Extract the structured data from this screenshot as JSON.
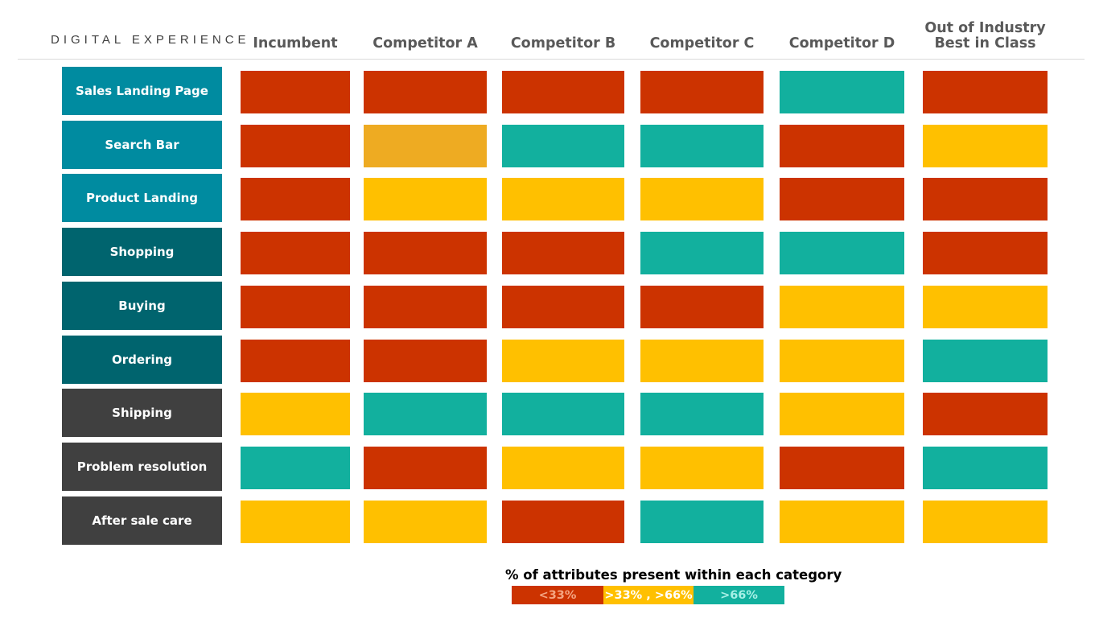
{
  "section_title": "DIGITAL EXPERIENCE",
  "chart_data": {
    "type": "heatmap",
    "title": "DIGITAL EXPERIENCE",
    "columns": [
      "Incumbent",
      "Competitor A",
      "Competitor B",
      "Competitor C",
      "Competitor D",
      "Out of Industry Best in Class"
    ],
    "column_labels": [
      [
        "Incumbent"
      ],
      [
        "Competitor A"
      ],
      [
        "Competitor B"
      ],
      [
        "Competitor C"
      ],
      [
        "Competitor D"
      ],
      [
        "Out of Industry",
        "Best in Class"
      ]
    ],
    "rows": [
      {
        "label": "Sales Landing Page",
        "group": "blue",
        "values": [
          "low",
          "low",
          "low",
          "low",
          "high",
          "low"
        ]
      },
      {
        "label": "Search Bar",
        "group": "blue",
        "values": [
          "low",
          "mid-alt",
          "high",
          "high",
          "low",
          "mid"
        ]
      },
      {
        "label": "Product Landing",
        "group": "blue",
        "values": [
          "low",
          "mid",
          "mid",
          "mid",
          "low",
          "low"
        ]
      },
      {
        "label": "Shopping",
        "group": "teal",
        "values": [
          "low",
          "low",
          "low",
          "high",
          "high",
          "low"
        ]
      },
      {
        "label": "Buying",
        "group": "teal",
        "values": [
          "low",
          "low",
          "low",
          "low",
          "mid",
          "mid"
        ]
      },
      {
        "label": "Ordering",
        "group": "teal",
        "values": [
          "low",
          "low",
          "mid",
          "mid",
          "mid",
          "high"
        ]
      },
      {
        "label": "Shipping",
        "group": "gray",
        "values": [
          "mid",
          "high",
          "high",
          "high",
          "mid",
          "low"
        ]
      },
      {
        "label": "Problem resolution",
        "group": "gray",
        "values": [
          "high",
          "low",
          "mid",
          "mid",
          "low",
          "high"
        ]
      },
      {
        "label": "After sale care",
        "group": "gray",
        "values": [
          "mid",
          "mid",
          "low",
          "high",
          "mid",
          "mid"
        ]
      }
    ],
    "legend": {
      "title": "% of attributes present within each category",
      "entries": [
        {
          "key": "low",
          "label": "<33%"
        },
        {
          "key": "mid",
          "label": ">33% , >66%"
        },
        {
          "key": "high",
          "label": ">66%"
        }
      ]
    }
  },
  "colors": {
    "low": "#CC3300",
    "mid": "#FFC000",
    "mid-alt": "#EEAB22",
    "high": "#12B09E",
    "group_blue": "#008BA0",
    "group_teal": "#00646E",
    "group_gray": "#404040",
    "legend_low_text": "#F4A582",
    "legend_mid_text": "#FFFFFF",
    "legend_high_text": "#A8F0E6"
  }
}
